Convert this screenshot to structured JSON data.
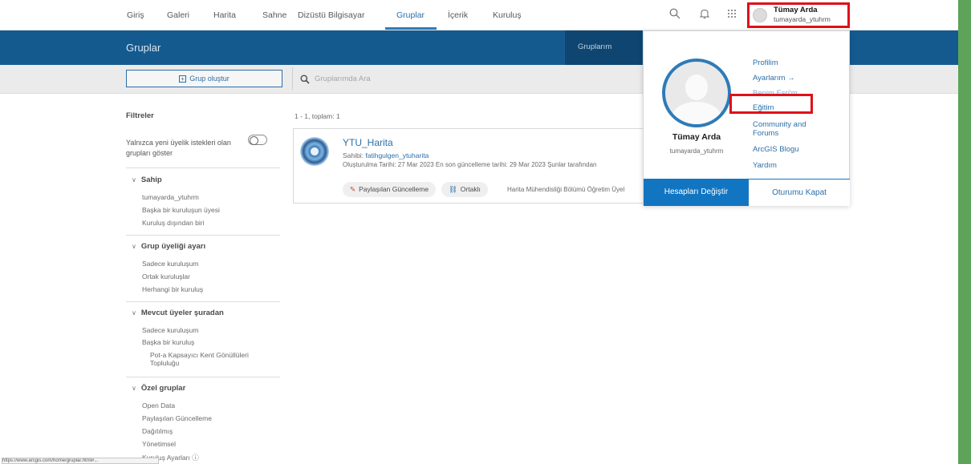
{
  "nav": {
    "items": [
      "Giriş",
      "Galeri",
      "Harita",
      "Sahne",
      "Dizüstü Bilgisayar",
      "Gruplar",
      "İçerik",
      "Kuruluş"
    ],
    "active": "Gruplar"
  },
  "user": {
    "name": "Tümay Arda",
    "username": "tumayarda_ytuhrm"
  },
  "header": {
    "title": "Gruplar",
    "tab": "Gruplarım"
  },
  "toolbar": {
    "create_label": "Grup oluştur",
    "search_placeholder": "Gruplarımda Ara"
  },
  "filters": {
    "title": "Filtreler",
    "toggle_label": "Yalnızca yeni üyelik istekleri olan grupları göster",
    "sections": [
      {
        "heading": "Sahip",
        "items": [
          "tumayarda_ytuhrm",
          "Başka bir kuruluşun üyesi",
          "Kuruluş dışından biri"
        ]
      },
      {
        "heading": "Grup üyeliği ayarı",
        "items": [
          "Sadece kuruluşum",
          "Ortak kuruluşlar",
          "Herhangi bir kuruluş"
        ]
      },
      {
        "heading": "Mevcut üyeler şuradan",
        "items": [
          "Sadece kuruluşum",
          "Başka bir kuruluş",
          "Pot-a Kapsayıcı Kent Gönüllüleri Topluluğu"
        ]
      },
      {
        "heading": "Özel gruplar",
        "items": [
          "Open Data",
          "Paylaşılan Güncelleme",
          "Dağıtılmış",
          "Yönetimsel",
          "Kuruluş Ayarları ⓘ"
        ]
      }
    ]
  },
  "results": {
    "count": "1 - 1, toplam: 1",
    "card": {
      "title": "YTU_Harita",
      "owner_prefix": "Sahibi:",
      "owner": "fatihgulgen_ytuharita",
      "dates": "Oluşturulma Tarihi: 27 Mar 2023   En son güncelleme tarihi: 29 Mar 2023   Şunlar tarafından",
      "chip1": "Paylaşılan Güncelleme",
      "chip2": "Ortaklı",
      "extra": "Harita Mühendisliği Bölümü Öğretim Üyel"
    }
  },
  "dropdown": {
    "links": [
      "Profilim",
      "Ayarlarım →",
      "Benim Esri'm",
      "Eğitim",
      "Community and Forums",
      "ArcGIS Blogu",
      "Yardım"
    ],
    "switch_label": "Hesapları Değiştir",
    "signout_label": "Oturumu Kapat"
  },
  "status_text": "https://www.arcgis.com/home/gruplar.html#..."
}
